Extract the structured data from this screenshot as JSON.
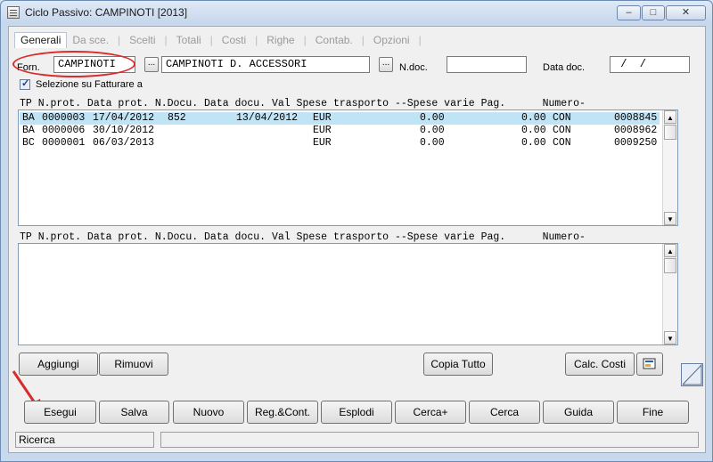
{
  "window": {
    "title": "Ciclo Passivo: CAMPINOTI  [2013]",
    "controls": [
      "–",
      "□",
      "✕"
    ]
  },
  "tabs": [
    {
      "label": "Generali",
      "active": true
    },
    {
      "label": "Da sce.",
      "active": false
    },
    {
      "label": "Scelti",
      "active": false
    },
    {
      "label": "Totali",
      "active": false
    },
    {
      "label": "Costi",
      "active": false
    },
    {
      "label": "Righe",
      "active": false
    },
    {
      "label": "Contab.",
      "active": false
    },
    {
      "label": "Opzioni",
      "active": false
    }
  ],
  "form": {
    "forn_label": "Forn.",
    "forn_code": "CAMPINOTI",
    "forn_name": "CAMPINOTI D. ACCESSORI",
    "ndoc_label": "N.doc.",
    "ndoc_value": "",
    "datadoc_label": "Data doc.",
    "datadoc_value": " /  /",
    "lookup_glyph": "...",
    "checkbox_label": "Selezione su Fatturare a",
    "checkbox_checked": true
  },
  "top_grid": {
    "header": "TP N.prot. Data prot. N.Docu. Data docu. Val Spese trasporto --Spese varie Pag.      Numero-",
    "rows": [
      {
        "tp": "BA",
        "nprot": "0000003",
        "dataprot": "17/04/2012",
        "ndocu": "852",
        "datadocu": "13/04/2012",
        "val": "EUR",
        "spese_trasp": "0.00",
        "spese_varie": "0.00",
        "pag": "CON",
        "numero": "0008845",
        "selected": true
      },
      {
        "tp": "BA",
        "nprot": "0000006",
        "dataprot": "30/10/2012",
        "ndocu": "",
        "datadocu": "",
        "val": "EUR",
        "spese_trasp": "0.00",
        "spese_varie": "0.00",
        "pag": "CON",
        "numero": "0008962",
        "selected": false
      },
      {
        "tp": "BC",
        "nprot": "0000001",
        "dataprot": "06/03/2013",
        "ndocu": "",
        "datadocu": "",
        "val": "EUR",
        "spese_trasp": "0.00",
        "spese_varie": "0.00",
        "pag": "CON",
        "numero": "0009250",
        "selected": false
      }
    ]
  },
  "bottom_grid": {
    "header": "TP N.prot. Data prot. N.Docu. Data docu. Val Spese trasporto --Spese varie Pag.      Numero-",
    "rows": []
  },
  "scroll_arrows": {
    "up": "▲",
    "down": "▼"
  },
  "middle_buttons": {
    "aggiungi": "Aggiungi",
    "rimuovi": "Rimuovi",
    "copia_tutto": "Copia Tutto",
    "calc_costi": "Calc. Costi"
  },
  "bottom_buttons": [
    "Esegui",
    "Salva",
    "Nuovo",
    "Reg.&Cont.",
    "Esplodi",
    "Cerca+",
    "Cerca",
    "Guida",
    "Fine"
  ],
  "status": {
    "left": "Ricerca",
    "right": ""
  },
  "annotation_color": "#d92b2b"
}
